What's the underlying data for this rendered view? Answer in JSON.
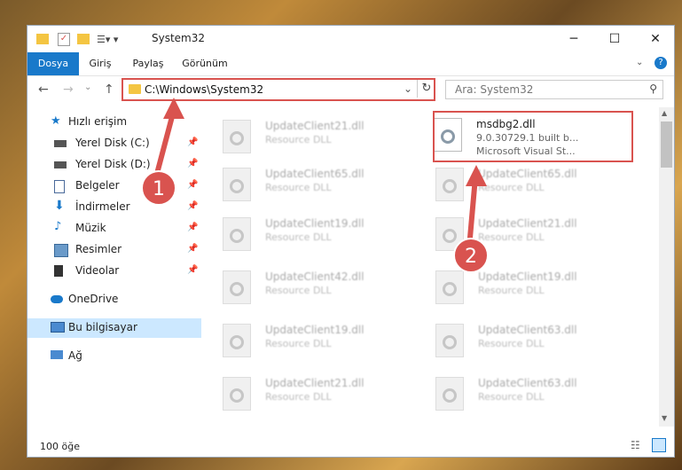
{
  "window": {
    "title": "System32"
  },
  "ribbon": {
    "tabs": [
      "Dosya",
      "Giriş",
      "Paylaş",
      "Görünüm"
    ]
  },
  "address": {
    "path": "C:\\Windows\\System32"
  },
  "search": {
    "placeholder": "Ara: System32"
  },
  "sidebar": {
    "quick_access": "Hızlı erişim",
    "items": [
      "Yerel Disk (C:)",
      "Yerel Disk (D:)",
      "Belgeler",
      "İndirmeler",
      "Müzik",
      "Resimler",
      "Videolar"
    ],
    "onedrive": "OneDrive",
    "this_pc": "Bu bilgisayar",
    "network": "Ağ"
  },
  "files": {
    "left": [
      {
        "name": "UpdateClient21.dll",
        "desc": "Resource DLL"
      },
      {
        "name": "UpdateClient65.dll",
        "desc": "Resource DLL"
      },
      {
        "name": "UpdateClient19.dll",
        "desc": "Resource DLL"
      },
      {
        "name": "UpdateClient42.dll",
        "desc": "Resource DLL"
      },
      {
        "name": "UpdateClient19.dll",
        "desc": "Resource DLL"
      },
      {
        "name": "UpdateClient21.dll",
        "desc": "Resource DLL"
      }
    ],
    "highlight": {
      "name": "msdbg2.dll",
      "line1": "9.0.30729.1 built b...",
      "line2": "Microsoft Visual St..."
    },
    "right": [
      {
        "name": "UpdateClient65.dll",
        "desc": "Resource DLL"
      },
      {
        "name": "UpdateClient21.dll",
        "desc": "Resource DLL"
      },
      {
        "name": "UpdateClient19.dll",
        "desc": "Resource DLL"
      },
      {
        "name": "UpdateClient63.dll",
        "desc": "Resource DLL"
      },
      {
        "name": "UpdateClient63.dll",
        "desc": "Resource DLL"
      }
    ]
  },
  "status": {
    "count": "100 öğe"
  },
  "callouts": [
    "1",
    "2"
  ],
  "colors": {
    "accent": "#1979ca",
    "highlight": "#d9534f",
    "selected": "#cce8ff"
  }
}
